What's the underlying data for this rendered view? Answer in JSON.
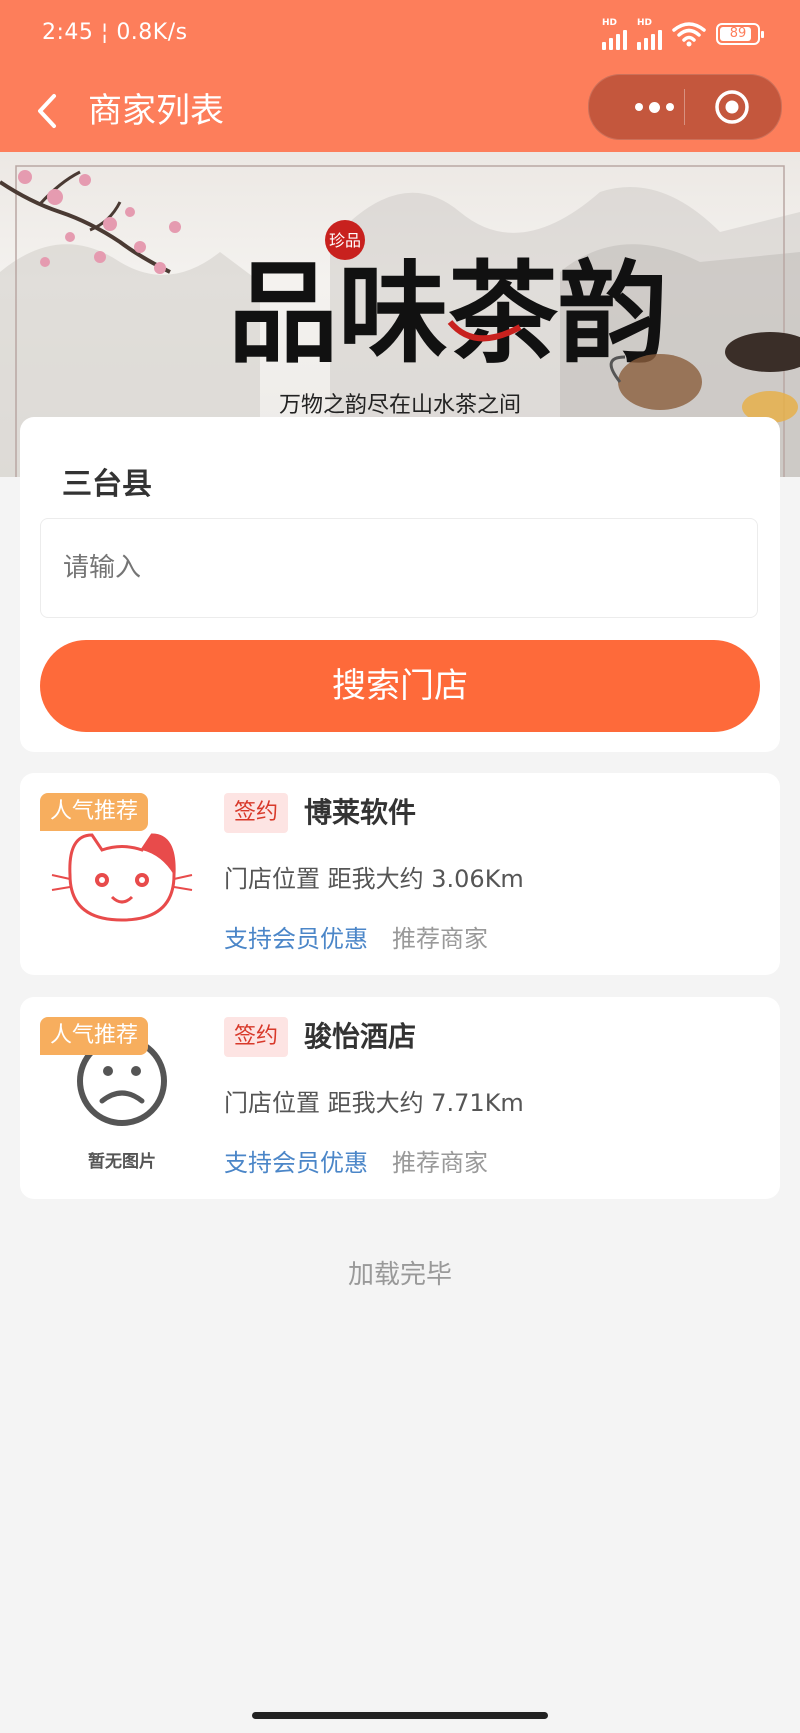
{
  "status_bar": {
    "time": "2:45",
    "net_speed": "0.8K/s",
    "signal_tag": "HD",
    "battery": "89"
  },
  "nav": {
    "title": "商家列表"
  },
  "banner": {
    "calligraphy": "品味茶韵",
    "seal": "珍品",
    "slogan": "万物之韵尽在山水茶之间"
  },
  "search": {
    "region": "三台县",
    "placeholder": "请输入",
    "button_label": "搜索门店"
  },
  "stores": [
    {
      "badge": "人气推荐",
      "tag": "签约",
      "name": "博莱软件",
      "distance": "门店位置 距我大约 3.06Km",
      "member": "支持会员优惠",
      "recommend": "推荐商家",
      "image": "cat-logo"
    },
    {
      "badge": "人气推荐",
      "tag": "签约",
      "name": "骏怡酒店",
      "distance": "门店位置 距我大约 7.71Km",
      "member": "支持会员优惠",
      "recommend": "推荐商家",
      "image": "no-image",
      "image_text": "暂无图片"
    }
  ],
  "footer": {
    "loaded_text": "加载完毕"
  },
  "colors": {
    "theme": "#fd7e5b",
    "button": "#fe6a3a",
    "badge": "#f7ae5e",
    "tag_bg": "#fde4e3",
    "tag_text": "#d8392a",
    "link": "#4b86c8"
  }
}
